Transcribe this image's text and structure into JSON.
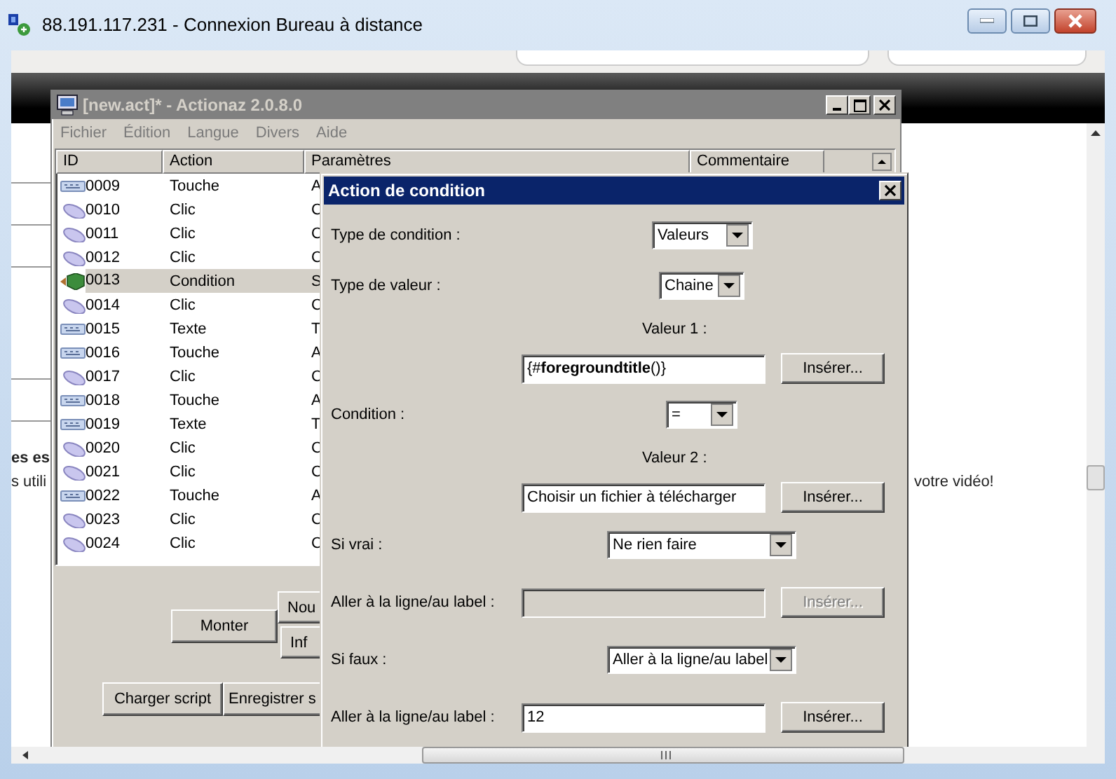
{
  "remote_window": {
    "title": "88.191.117.231 - Connexion Bureau à distance"
  },
  "web_page": {
    "texts": [
      {
        "kind": "left-bold",
        "text": "es es"
      },
      {
        "kind": "left",
        "text": "s utili"
      },
      {
        "kind": "right",
        "text": "votre vidéo!"
      }
    ]
  },
  "app_window": {
    "title": "[new.act]* - Actionaz 2.0.8.0",
    "menu": [
      "Fichier",
      "Édition",
      "Langue",
      "Divers",
      "Aide"
    ],
    "table": {
      "columns": [
        "ID",
        "Action",
        "Paramètres",
        "Commentaire"
      ],
      "rows": [
        {
          "id": "0009",
          "action": "Touche",
          "param": "A",
          "kind": "keyboard",
          "selected": false
        },
        {
          "id": "0010",
          "action": "Clic",
          "param": "C",
          "kind": "mouse",
          "selected": false
        },
        {
          "id": "0011",
          "action": "Clic",
          "param": "C",
          "kind": "mouse",
          "selected": false
        },
        {
          "id": "0012",
          "action": "Clic",
          "param": "C",
          "kind": "mouse",
          "selected": false
        },
        {
          "id": "0013",
          "action": "Condition",
          "param": "S",
          "kind": "condition",
          "selected": true
        },
        {
          "id": "0014",
          "action": "Clic",
          "param": "C",
          "kind": "mouse",
          "selected": false
        },
        {
          "id": "0015",
          "action": "Texte",
          "param": "T",
          "kind": "keyboard",
          "selected": false
        },
        {
          "id": "0016",
          "action": "Touche",
          "param": "A",
          "kind": "keyboard",
          "selected": false
        },
        {
          "id": "0017",
          "action": "Clic",
          "param": "C",
          "kind": "mouse",
          "selected": false
        },
        {
          "id": "0018",
          "action": "Touche",
          "param": "A",
          "kind": "keyboard",
          "selected": false
        },
        {
          "id": "0019",
          "action": "Texte",
          "param": "T",
          "kind": "keyboard",
          "selected": false
        },
        {
          "id": "0020",
          "action": "Clic",
          "param": "C",
          "kind": "mouse",
          "selected": false
        },
        {
          "id": "0021",
          "action": "Clic",
          "param": "C",
          "kind": "mouse",
          "selected": false
        },
        {
          "id": "0022",
          "action": "Touche",
          "param": "A",
          "kind": "keyboard",
          "selected": false
        },
        {
          "id": "0023",
          "action": "Clic",
          "param": "C",
          "kind": "mouse",
          "selected": false
        },
        {
          "id": "0024",
          "action": "Clic",
          "param": "C",
          "kind": "mouse",
          "selected": false
        }
      ]
    },
    "buttons": [
      {
        "kind": "move",
        "label": "Monter"
      },
      {
        "kind": "new",
        "label": "Nou"
      },
      {
        "kind": "info",
        "label": "Inf"
      },
      {
        "kind": "load",
        "label": "Charger script"
      },
      {
        "kind": "save",
        "label": "Enregistrer s"
      }
    ]
  },
  "dialog": {
    "title": "Action de condition",
    "rows": [
      {
        "kind": "combo",
        "label": "Type de condition :",
        "value": "Valeurs"
      },
      {
        "kind": "combo",
        "label": "Type de valeur :",
        "value": "Chaine"
      },
      {
        "kind": "caption",
        "text": "Valeur 1 :"
      },
      {
        "kind": "input",
        "value": "{#**foregroundtitle**()}",
        "button": "Insérer...",
        "disabled": false
      },
      {
        "kind": "combo",
        "label": "Condition :",
        "value": "="
      },
      {
        "kind": "caption",
        "text": "Valeur 2 :"
      },
      {
        "kind": "input",
        "value": "Choisir un fichier à télécharger",
        "button": "Insérer...",
        "disabled": false
      },
      {
        "kind": "combo",
        "label": "Si vrai :",
        "value": "Ne rien faire"
      },
      {
        "kind": "input",
        "label": "Aller à la ligne/au label :",
        "button": "Insérer...",
        "disabled": true
      },
      {
        "kind": "combo",
        "label": "Si faux :",
        "value": "Aller à la ligne/au label"
      },
      {
        "kind": "input",
        "label": "Aller à la ligne/au label :",
        "value": "12",
        "button": "Insérer...",
        "disabled": false
      }
    ]
  }
}
